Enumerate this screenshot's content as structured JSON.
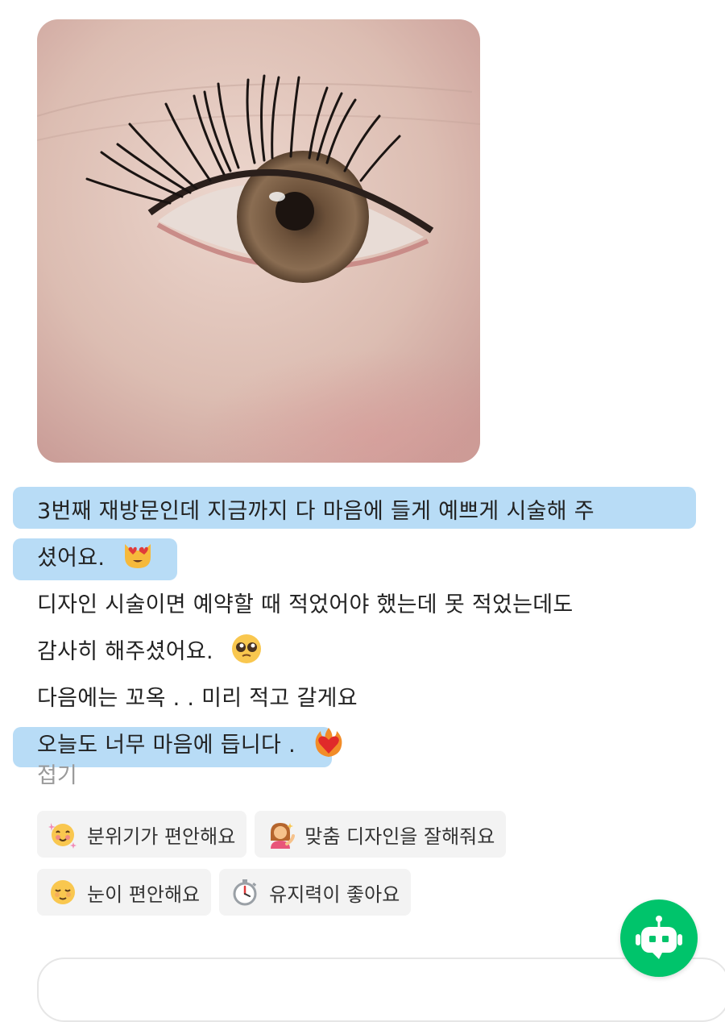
{
  "review": {
    "lines": [
      "3번째 재방문인데 지금까지 다 마음에 들게 예쁘게 시술해 주",
      "셨어요.",
      "디자인 시술이면 예약할 때 적었어야 했는데 못 적었는데도",
      "감사히 해주셨어요.",
      "다음에는 꼬옥 . . 미리 적고 갈게요",
      "오늘도 너무 마음에 듭니다 ."
    ],
    "emoji_names": [
      "heart-eyes-cat-emoji",
      "pleading-face-emoji",
      "heart-on-fire-emoji"
    ],
    "highlight_color": "#b8dcf6"
  },
  "collapse_label": "접기",
  "tags": [
    {
      "label": "분위기가 편안해요",
      "icon": "smiling-face-icon"
    },
    {
      "label": "맞춤 디자인을 잘해줘요",
      "icon": "person-tipping-hand-icon"
    },
    {
      "label": "눈이 편안해요",
      "icon": "relieved-face-icon"
    },
    {
      "label": "유지력이 좋아요",
      "icon": "stopwatch-icon"
    }
  ],
  "colors": {
    "accent": "#00c46b",
    "tag_bg": "#f3f3f3",
    "muted_text": "#9a9a9a"
  }
}
